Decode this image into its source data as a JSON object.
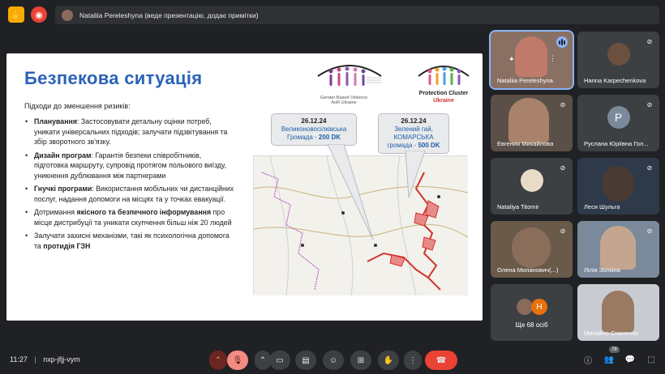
{
  "banner": {
    "text": "Nataliia Pereleshyna (веде презентацію, додає примітки)"
  },
  "slide": {
    "title": "Безпекова ситуація",
    "intro": "Підходи до зменшення ризиків:",
    "bullets": [
      {
        "bold": "Планування",
        "text": ": Застосовувати детальну оцінки потреб, уникати  універсальних підходів; залучати підзвітування та збір зворотного зв'язку."
      },
      {
        "bold": "Дизайн програм",
        "text": ": Гарантія безпеки співробітників, підготовка маршруту, супровід протягом польового виїзду,  уникнення дублювання між партнерами"
      },
      {
        "bold": "Гнучкі програми",
        "text": ": Використання мобільних чи дистанційних послуг, надання допомоги на місцях та у точках евакуації."
      },
      {
        "pre": "Дотримання ",
        "bold": "якісного та безпечного інформування",
        "text": " про місце дистрибуції та уникати скупчення більш ніж 20 людей"
      },
      {
        "pre": "Залучати захисні механізми, такі як психологічна допомога та ",
        "bold": "протидія ГЗН",
        "text": ""
      }
    ],
    "logo1_text": "Gender-Based Violence AoR Ukraine",
    "logo2_title": "Protection Cluster",
    "logo2_sub": "Ukraine",
    "callout1": {
      "date": "26.12.24",
      "line1": "Великоновосілківська",
      "line2": "Громада - ",
      "value": "200 DK"
    },
    "callout2": {
      "date": "26.12.24",
      "line1": "Зелений гай,",
      "line2": "КОМАРСЬКА",
      "line3": "громада - ",
      "value": "500 DK"
    }
  },
  "participants": [
    {
      "name": "Nataliia Pereleshyna",
      "speaking": true
    },
    {
      "name": "Hanna Karpechenkova"
    },
    {
      "name": "Евгения Михайлова"
    },
    {
      "name": "Руслана Юріївна Гол...",
      "initial": "P"
    },
    {
      "name": "Nataliya Titomir"
    },
    {
      "name": "Леся Шульга"
    },
    {
      "name": "Олена Миланович(...)"
    },
    {
      "name": "Лілія Золкіна"
    },
    {
      "name": "Ще 68 осіб",
      "initial": "H"
    },
    {
      "name": "Михайло Сноленко"
    }
  ],
  "bottom": {
    "time": "11:27",
    "separator": "|",
    "meeting_code": "nxp-jfjj-vym",
    "people_count": "78"
  },
  "colors": {
    "accent": "#8ab4f8",
    "end_call": "#ea4335",
    "title_blue": "#2a62b8"
  }
}
